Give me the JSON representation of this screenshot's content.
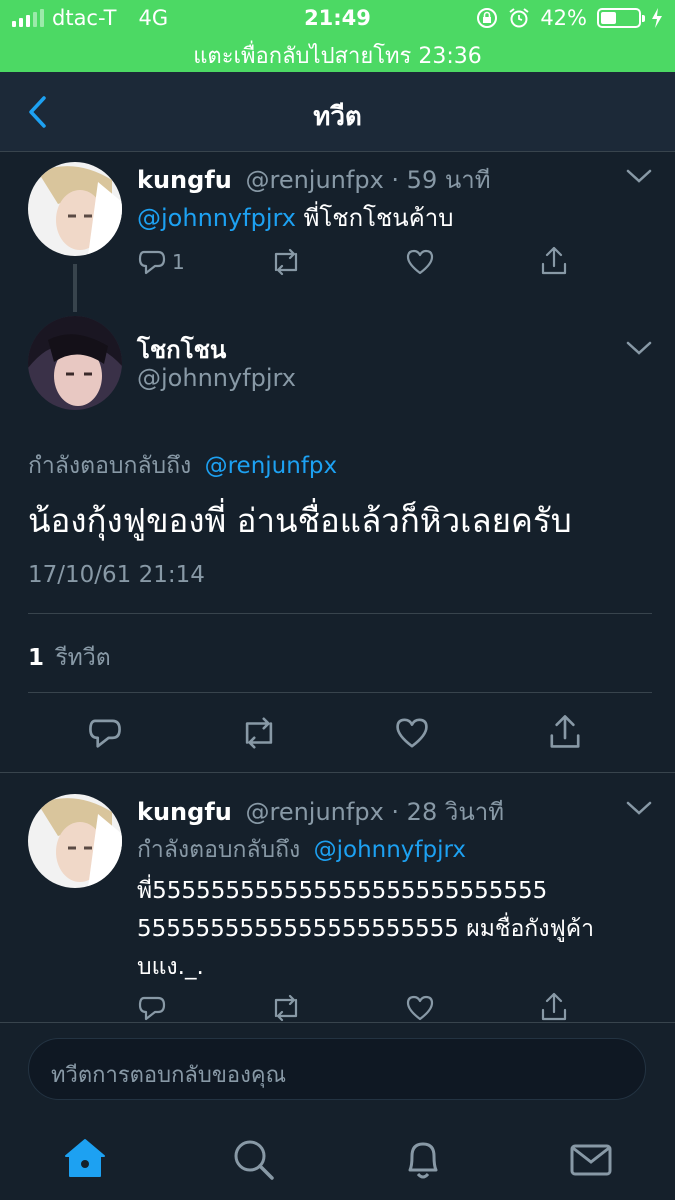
{
  "status_bar": {
    "carrier": "dtac-T",
    "network": "4G",
    "time": "21:49",
    "battery": "42%",
    "battery_level": 0.42,
    "call_banner": "แตะเพื่อกลับไปสายโทร 23:36"
  },
  "nav": {
    "title": "ทวีต"
  },
  "tweet1": {
    "display_name": "kungfu",
    "handle": "@renjunfpx",
    "time": "· 59 นาที",
    "mention": "@johnnyfpjrx",
    "text": " พี่โชกโชนค้าบ",
    "reply_count": "1"
  },
  "main_tweet": {
    "display_name": "โชกโชน",
    "handle": "@johnnyfpjrx",
    "replying_to_label": "กำลังตอบกลับถึง",
    "replying_to": "@renjunfpx",
    "text": "น้องกุ้งฟูของพี่ อ่านชื่อแล้วก็หิวเลยครับ",
    "timestamp": "17/10/61 21:14",
    "retweet_count": "1",
    "retweet_label": "รีทวีต"
  },
  "tweet3": {
    "display_name": "kungfu",
    "handle": "@renjunfpx",
    "time": "· 28 วินาที",
    "replying_to_label": "กำลังตอบกลับถึง",
    "replying_to": "@johnnyfpjrx",
    "text_line1": "พี่555555555555555555555555555",
    "text_line2": "5555555555555555555555 ผมชื่อกังฟูค้า",
    "text_line3": "บแง._."
  },
  "reply": {
    "placeholder": "ทวีตการตอบกลับของคุณ"
  },
  "tabs": [
    "home-icon",
    "search-icon",
    "bell-icon",
    "mail-icon"
  ],
  "colors": {
    "accent": "#1da1f2",
    "background": "#15202b",
    "status_bar": "#4cd964"
  }
}
